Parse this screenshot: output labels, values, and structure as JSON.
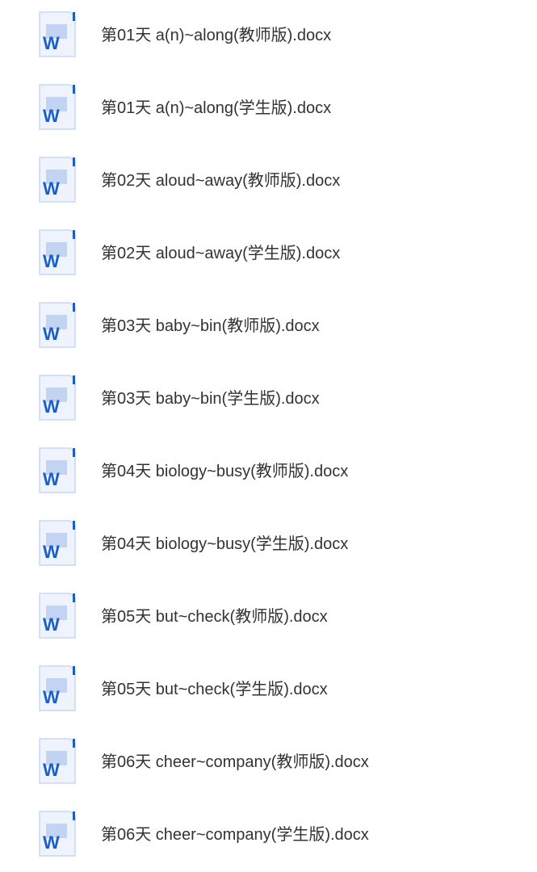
{
  "files": [
    {
      "name": "第01天 a(n)~along(教师版).docx",
      "icon": "word-document-icon"
    },
    {
      "name": "第01天 a(n)~along(学生版).docx",
      "icon": "word-document-icon"
    },
    {
      "name": "第02天 aloud~away(教师版).docx",
      "icon": "word-document-icon"
    },
    {
      "name": "第02天 aloud~away(学生版).docx",
      "icon": "word-document-icon"
    },
    {
      "name": "第03天 baby~bin(教师版).docx",
      "icon": "word-document-icon"
    },
    {
      "name": "第03天 baby~bin(学生版).docx",
      "icon": "word-document-icon"
    },
    {
      "name": "第04天 biology~busy(教师版).docx",
      "icon": "word-document-icon"
    },
    {
      "name": "第04天 biology~busy(学生版).docx",
      "icon": "word-document-icon"
    },
    {
      "name": "第05天 but~check(教师版).docx",
      "icon": "word-document-icon"
    },
    {
      "name": "第05天 but~check(学生版).docx",
      "icon": "word-document-icon"
    },
    {
      "name": "第06天 cheer~company(教师版).docx",
      "icon": "word-document-icon"
    },
    {
      "name": "第06天 cheer~company(学生版).docx",
      "icon": "word-document-icon"
    }
  ],
  "icon_glyph": "W",
  "colors": {
    "text": "#333333",
    "icon_letter": "#1a5ec7",
    "icon_corner": "#1a5ec7",
    "icon_bg": "#eef3fd",
    "icon_border": "#c9d8f3",
    "icon_band": "#c3d3f2"
  }
}
